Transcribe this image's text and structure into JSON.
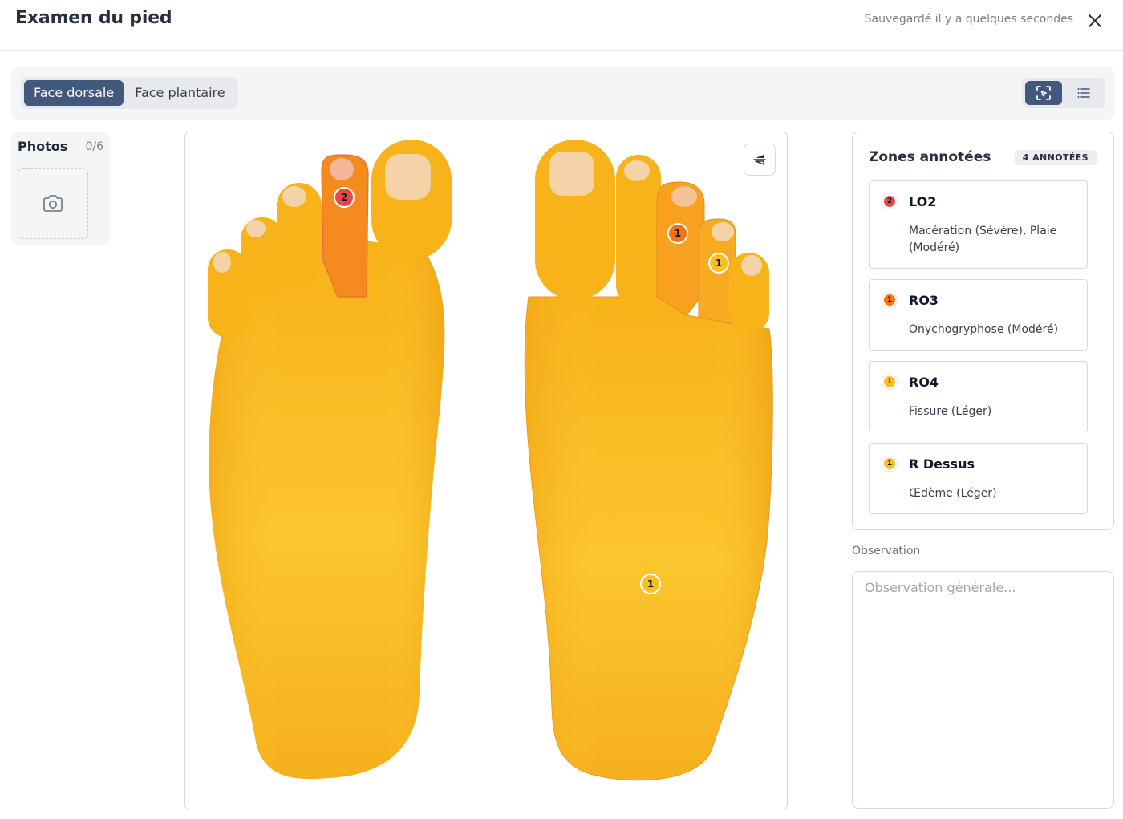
{
  "header": {
    "title": "Examen du pied",
    "saved_status": "Sauvegardé il y a quelques secondes",
    "close_icon": "close-icon"
  },
  "toolbar": {
    "tabs": [
      {
        "label": "Face dorsale",
        "active": true
      },
      {
        "label": "Face plantaire",
        "active": false
      }
    ],
    "view_modes": [
      {
        "icon": "annotate-view-icon",
        "active": true
      },
      {
        "icon": "list-view-icon",
        "active": false
      }
    ]
  },
  "photos": {
    "title": "Photos",
    "count": "0/6",
    "add_icon": "camera-icon"
  },
  "canvas": {
    "flip_icon": "flip-icon",
    "markers": [
      {
        "zone": "LO2",
        "label": "2",
        "severity": "severe"
      },
      {
        "zone": "RO3",
        "label": "1",
        "severity": "moderate"
      },
      {
        "zone": "RO4",
        "label": "1",
        "severity": "mild"
      },
      {
        "zone": "R Dessus",
        "label": "1",
        "severity": "mild"
      }
    ]
  },
  "zones": {
    "title": "Zones annotées",
    "badge": "4 ANNOTÉES",
    "items": [
      {
        "dot": "2",
        "name": "LO2",
        "description": "Macération (Sévère), Plaie (Modéré)",
        "color": "#ef4444"
      },
      {
        "dot": "1",
        "name": "RO3",
        "description": "Onychogryphose (Modéré)",
        "color": "#f97316"
      },
      {
        "dot": "1",
        "name": "RO4",
        "description": "Fissure (Léger)",
        "color": "#fbbf24"
      },
      {
        "dot": "1",
        "name": "R Dessus",
        "description": "Œdème (Léger)",
        "color": "#fbbf24"
      }
    ]
  },
  "observation": {
    "label": "Observation",
    "placeholder": "Observation générale...",
    "value": ""
  },
  "colors": {
    "accent": "#42587c",
    "severe": "#ef4444",
    "moderate": "#f97316",
    "mild": "#fbbf24",
    "foot": "#f7b418"
  }
}
